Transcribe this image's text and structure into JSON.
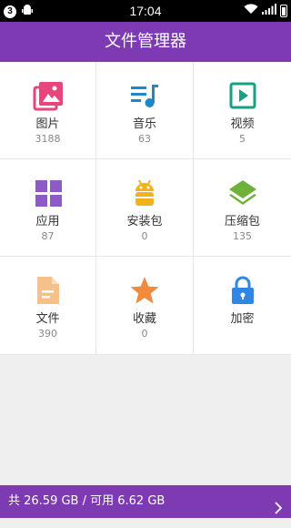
{
  "status_bar": {
    "notification_count": "3",
    "time": "17:04"
  },
  "header": {
    "title": "文件管理器"
  },
  "grid": [
    {
      "label": "图片",
      "count": "3188",
      "icon": "gallery-icon",
      "color": "#e8457c"
    },
    {
      "label": "音乐",
      "count": "63",
      "icon": "music-icon",
      "color": "#1e88c7"
    },
    {
      "label": "视频",
      "count": "5",
      "icon": "video-icon",
      "color": "#16a085"
    },
    {
      "label": "应用",
      "count": "87",
      "icon": "apps-icon",
      "color": "#8e5bc6"
    },
    {
      "label": "安装包",
      "count": "0",
      "icon": "android-icon",
      "color": "#f2b21a"
    },
    {
      "label": "压缩包",
      "count": "135",
      "icon": "layers-icon",
      "color": "#6fb23b"
    },
    {
      "label": "文件",
      "count": "390",
      "icon": "document-icon",
      "color": "#f6c08a"
    },
    {
      "label": "收藏",
      "count": "0",
      "icon": "star-icon",
      "color": "#f08a3c"
    },
    {
      "label": "加密",
      "count": "",
      "icon": "lock-icon",
      "color": "#2f86e6"
    }
  ],
  "storage_bar": {
    "text": "共 26.59 GB / 可用 6.62 GB"
  }
}
